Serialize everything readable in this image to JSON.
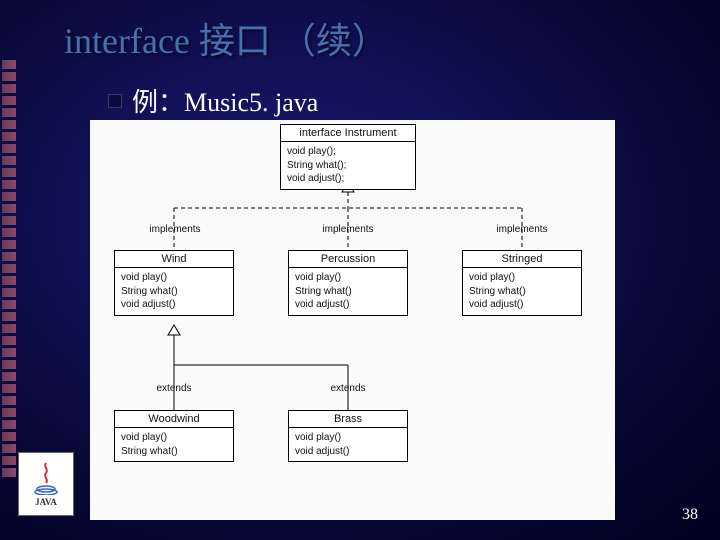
{
  "title": "interface 接口 （续）",
  "example_label": "例：Music5. java",
  "page_number": "38",
  "java_logo_text": "JAVA",
  "diagram": {
    "interface": {
      "title": "interface Instrument",
      "body": "void play();\nString what();\nvoid adjust();"
    },
    "edges_impl": [
      "implements",
      "implements",
      "implements"
    ],
    "edges_ext": [
      "extends",
      "extends"
    ],
    "classes": [
      {
        "name": "Wind",
        "body": "void play()\nString what()\nvoid adjust()"
      },
      {
        "name": "Percussion",
        "body": "void play()\nString what()\nvoid adjust()"
      },
      {
        "name": "Stringed",
        "body": "void play()\nString what()\nvoid adjust()"
      }
    ],
    "subclasses": [
      {
        "name": "Woodwind",
        "body": "void play()\nString what()"
      },
      {
        "name": "Brass",
        "body": "void play()\nvoid adjust()"
      }
    ]
  }
}
